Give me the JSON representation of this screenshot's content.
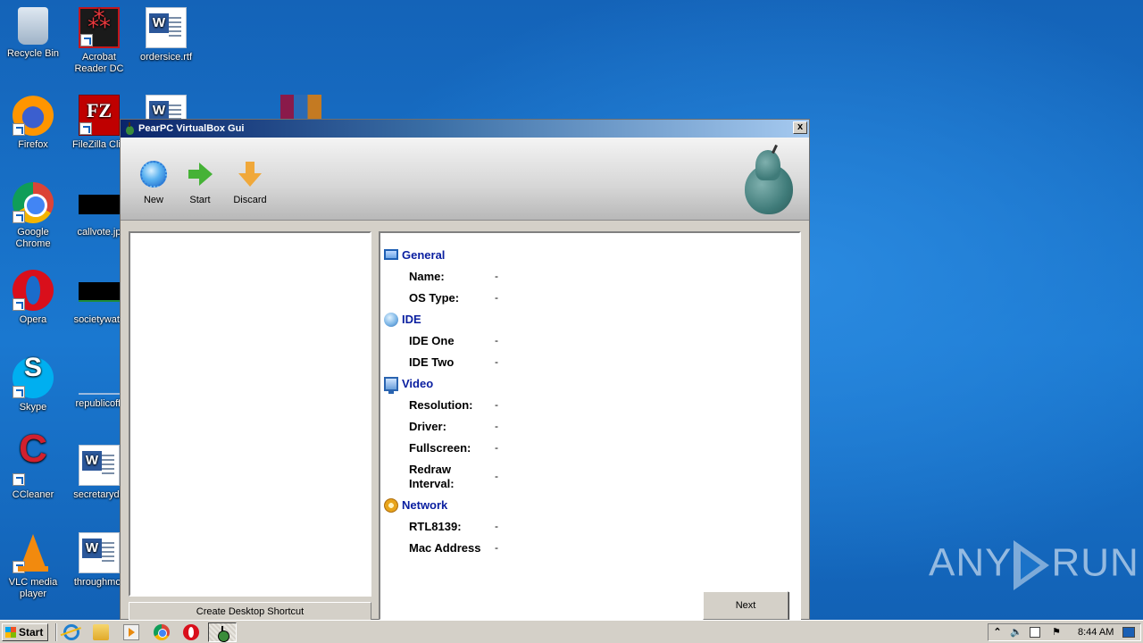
{
  "desktop": {
    "icons": [
      {
        "label": "Recycle Bin",
        "icon": "recycle-bin-icon"
      },
      {
        "label": "Acrobat Reader DC",
        "icon": "acrobat-icon"
      },
      {
        "label": "ordersice.rtf",
        "icon": "word-document-icon"
      },
      {
        "label": "Firefox",
        "icon": "firefox-icon"
      },
      {
        "label": "FileZilla Clie",
        "icon": "filezilla-icon"
      },
      {
        "label": "Google Chrome",
        "icon": "chrome-icon"
      },
      {
        "label": "callvote.jp",
        "icon": "image-thumbnail-icon"
      },
      {
        "label": "Opera",
        "icon": "opera-icon"
      },
      {
        "label": "societywatc",
        "icon": "image-thumbnail-icon"
      },
      {
        "label": "Skype",
        "icon": "skype-icon"
      },
      {
        "label": "republicoffi",
        "icon": "image-thumbnail-icon"
      },
      {
        "label": "CCleaner",
        "icon": "ccleaner-icon"
      },
      {
        "label": "secretaryde",
        "icon": "word-document-icon"
      },
      {
        "label": "VLC media player",
        "icon": "vlc-icon"
      },
      {
        "label": "throughmor",
        "icon": "word-document-icon"
      }
    ]
  },
  "window": {
    "title": "PearPC VirtualBox Gui",
    "close_label": "x",
    "toolbar": {
      "new_label": "New",
      "start_label": "Start",
      "discard_label": "Discard"
    },
    "shortcut_button": "Create Desktop Shortcut",
    "next_button": "Next",
    "details": {
      "general": {
        "title": "General",
        "name_label": "Name:",
        "name_value": "-",
        "ostype_label": "OS Type:",
        "ostype_value": "-"
      },
      "ide": {
        "title": "IDE",
        "one_label": "IDE One",
        "one_value": "-",
        "two_label": "IDE Two",
        "two_value": "-"
      },
      "video": {
        "title": "Video",
        "resolution_label": "Resolution:",
        "resolution_value": "-",
        "driver_label": "Driver:",
        "driver_value": "-",
        "fullscreen_label": "Fullscreen:",
        "fullscreen_value": "-",
        "redraw_label": "Redraw Interval:",
        "redraw_value": "-"
      },
      "network": {
        "title": "Network",
        "rtl_label": "RTL8139:",
        "rtl_value": "-",
        "mac_label": "Mac Address",
        "mac_value": "-"
      }
    }
  },
  "watermark": {
    "left": "ANY",
    "right": "RUN"
  },
  "taskbar": {
    "start_label": "Start",
    "clock": "8:44 AM"
  }
}
